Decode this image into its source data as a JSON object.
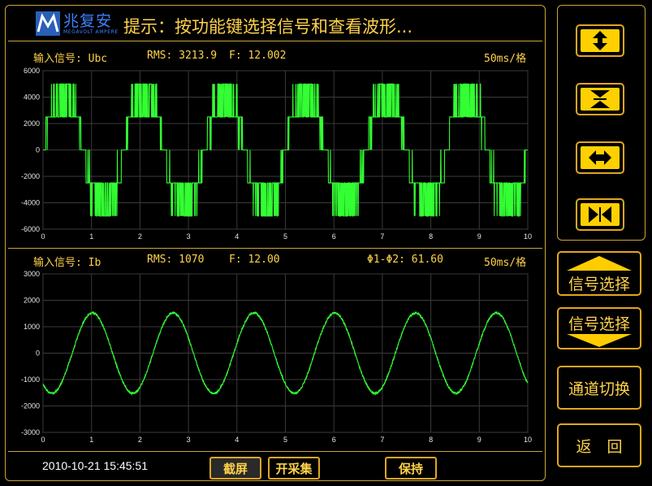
{
  "header": {
    "logo_text": "兆复安",
    "logo_sub": "MEGAVOLT AMPERE",
    "hint": "提示：按功能键选择信号和查看波形..."
  },
  "plot1": {
    "label": "输入信号: Ubc",
    "rms": "RMS: 3213.9",
    "freq": "F: 12.002",
    "phase": "",
    "timebase": "50ms/格"
  },
  "plot2": {
    "label": "输入信号: Ib",
    "rms": "RMS: 1070",
    "freq": "F: 12.00",
    "phase": "Φ1-Φ2: 61.60",
    "timebase": "50ms/格"
  },
  "chart_data": [
    {
      "type": "line",
      "series": [
        {
          "name": "",
          "shape": "pwm stepped",
          "amplitude": 5000,
          "periods": 6
        }
      ],
      "xlim": [
        0,
        10
      ],
      "ylim": [
        -6000,
        6000
      ],
      "xticks": [
        0,
        1,
        2,
        3,
        4,
        5,
        6,
        7,
        8,
        9,
        10
      ],
      "yticks": [
        6000,
        4000,
        2000,
        0,
        -2000,
        -4000,
        -6000
      ],
      "grid": true,
      "color": "#33ff33"
    },
    {
      "type": "line",
      "series": [
        {
          "name": "",
          "shape": "sine",
          "amplitude": 1520,
          "periods": 6,
          "phase_deg": -130
        }
      ],
      "xlim": [
        0,
        10
      ],
      "ylim": [
        -3000,
        3000
      ],
      "xticks": [
        0,
        1,
        2,
        3,
        4,
        5,
        6,
        7,
        8,
        9,
        10
      ],
      "yticks": [
        3000,
        2000,
        1000,
        0,
        -1000,
        -2000,
        -3000
      ],
      "grid": true,
      "color": "#33ff33"
    }
  ],
  "side_buttons": {
    "signal_prev": "信号选择",
    "signal_next": "信号选择",
    "channel_switch": "通道切换",
    "back": "返　回"
  },
  "footer": {
    "datetime": "2010-10-21 15:45:51",
    "screenshot": "截屏",
    "start_acq": "开采集",
    "hold": "保持"
  }
}
